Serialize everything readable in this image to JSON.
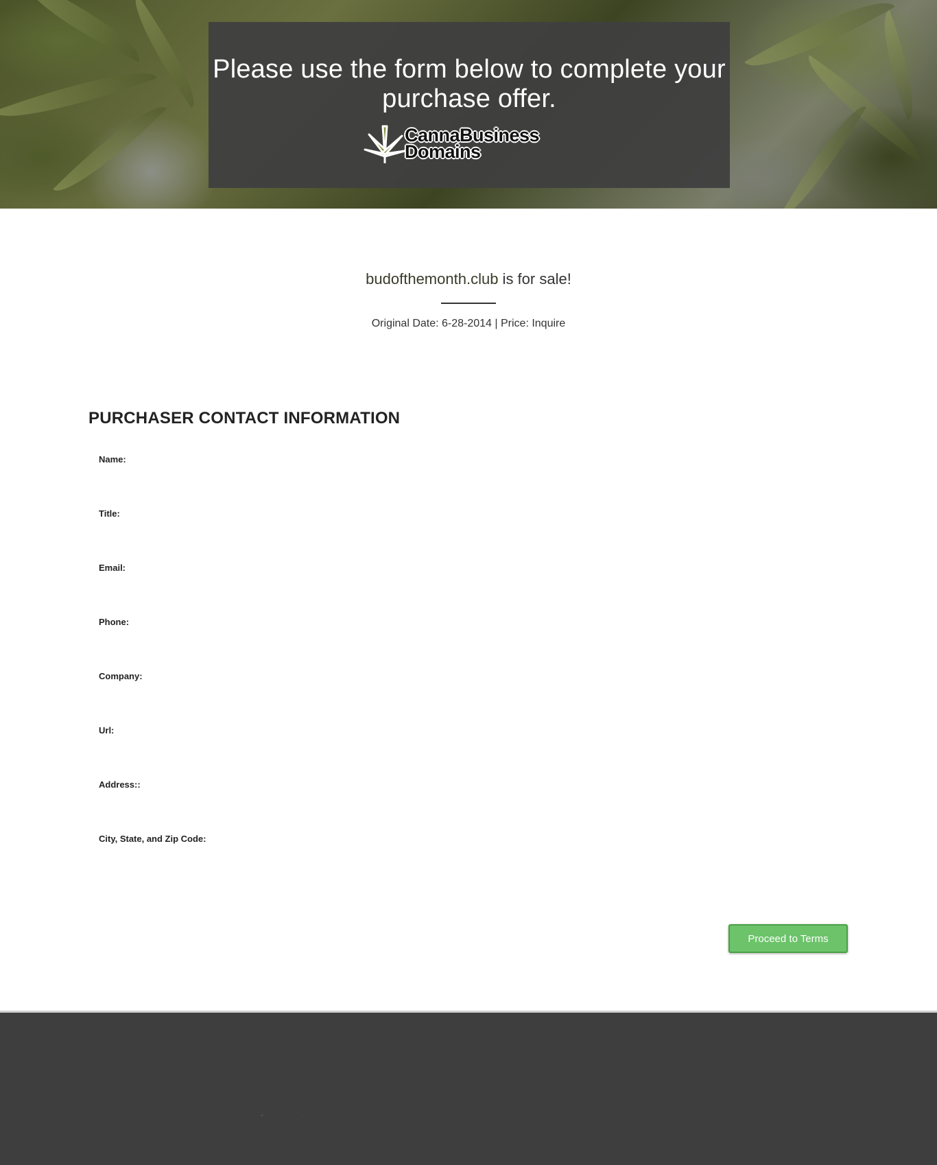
{
  "hero": {
    "title": "Please use the form below to complete your purchase offer.",
    "logo": {
      "line1": "CannaBusiness",
      "line2": "Domains"
    }
  },
  "listing": {
    "domain": "budofthemonth.club",
    "sale_suffix": " is for sale!",
    "meta": "Original Date: 6-28-2014 | Price: Inquire"
  },
  "form": {
    "section_title": "PURCHASER CONTACT INFORMATION",
    "fields": [
      {
        "label": "Name:",
        "value": ""
      },
      {
        "label": "Title:",
        "value": ""
      },
      {
        "label": "Email:",
        "value": ""
      },
      {
        "label": "Phone:",
        "value": ""
      },
      {
        "label": "Company:",
        "value": ""
      },
      {
        "label": "Url:",
        "value": ""
      },
      {
        "label": "Address::",
        "value": ""
      },
      {
        "label": "City, State, and Zip Code:",
        "value": ""
      }
    ],
    "submit_label": "Proceed to Terms"
  },
  "colors": {
    "hero_box": "#404040",
    "submit_button": "#6cc36a",
    "footer": "#3e3e3e"
  }
}
